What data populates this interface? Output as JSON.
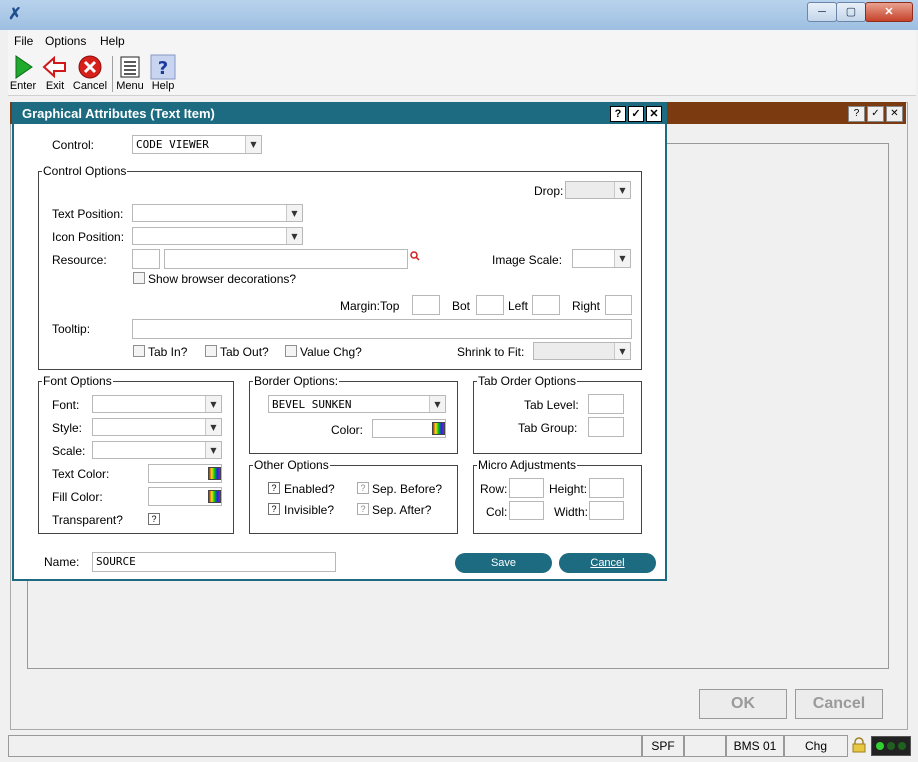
{
  "menu": {
    "items": [
      "File",
      "Options",
      "Help"
    ]
  },
  "toolbar": {
    "enter": "Enter",
    "exit": "Exit",
    "cancel": "Cancel",
    "menu": "Menu",
    "help": "Help"
  },
  "dialog": {
    "title": "Graphical Attributes (Text Item)",
    "control_label": "Control:",
    "control_value": "CODE VIEWER",
    "control_options": {
      "legend": "Control Options",
      "drop_label": "Drop:",
      "text_position_label": "Text Position:",
      "icon_position_label": "Icon Position:",
      "resource_label": "Resource:",
      "image_scale_label": "Image Scale:",
      "show_browser_label": "Show browser decorations?",
      "margin_top_label": "Margin:Top",
      "bot_label": "Bot",
      "left_label": "Left",
      "right_label": "Right",
      "tooltip_label": "Tooltip:",
      "tab_in_label": "Tab In?",
      "tab_out_label": "Tab Out?",
      "value_chg_label": "Value Chg?",
      "shrink_label": "Shrink to Fit:"
    },
    "font_options": {
      "legend": "Font Options",
      "font_label": "Font:",
      "style_label": "Style:",
      "scale_label": "Scale:",
      "text_color_label": "Text Color:",
      "fill_color_label": "Fill Color:",
      "transparent_label": "Transparent?",
      "transparent_value": "?"
    },
    "border_options": {
      "legend": "Border Options:",
      "border_value": "BEVEL SUNKEN",
      "color_label": "Color:"
    },
    "other_options": {
      "legend": "Other Options",
      "enabled_label": "Enabled?",
      "invisible_label": "Invisible?",
      "sep_before_label": "Sep. Before?",
      "sep_after_label": "Sep. After?",
      "check_value": "?"
    },
    "tab_order": {
      "legend": "Tab Order Options",
      "level_label": "Tab Level:",
      "group_label": "Tab Group:"
    },
    "micro": {
      "legend": "Micro Adjustments",
      "row_label": "Row:",
      "height_label": "Height:",
      "col_label": "Col:",
      "width_label": "Width:"
    },
    "name_label": "Name:",
    "name_value": "SOURCE",
    "save_label": "Save",
    "cancel_label": "Cancel",
    "title_buttons": [
      "?",
      "✓",
      "✕"
    ]
  },
  "background_window": {
    "title_buttons": [
      "?",
      "✓",
      "✕"
    ],
    "ok_label": "OK",
    "cancel_label": "Cancel"
  },
  "status": {
    "cells": [
      "SPF",
      "",
      "BMS 01",
      "Chg"
    ]
  },
  "window": {
    "min": "─",
    "max": "▢",
    "close": "✕"
  }
}
